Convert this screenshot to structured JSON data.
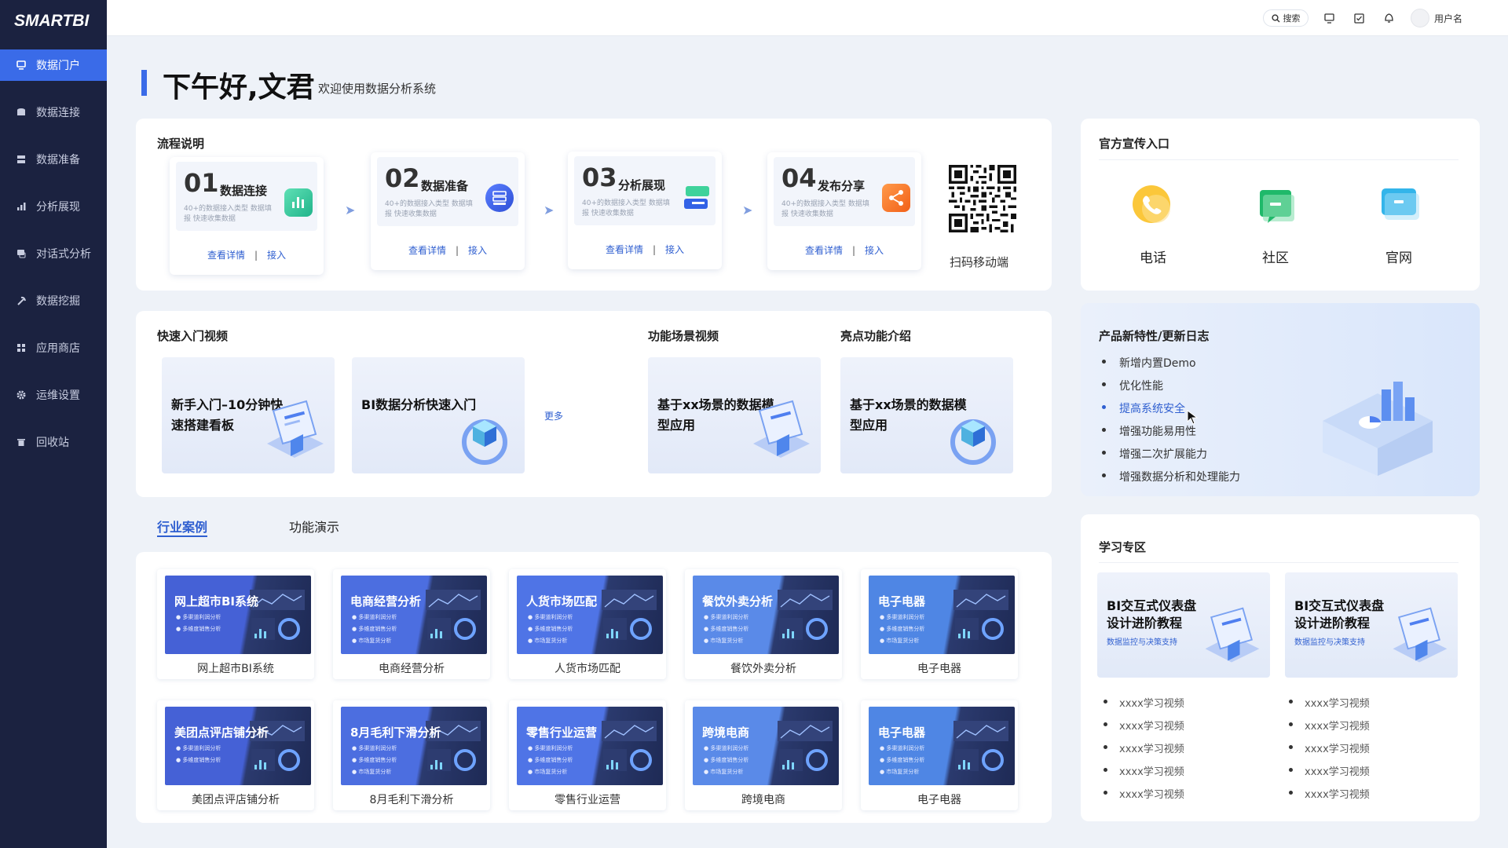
{
  "app": {
    "logo": "SMARTBI"
  },
  "sidebar": {
    "items": [
      {
        "label": "数据门户",
        "icon": "portal-icon"
      },
      {
        "label": "数据连接",
        "icon": "database-icon"
      },
      {
        "label": "数据准备",
        "icon": "prepare-icon"
      },
      {
        "label": "分析展现",
        "icon": "bar-chart-icon"
      },
      {
        "label": "对话式分析",
        "icon": "chat-icon"
      },
      {
        "label": "数据挖掘",
        "icon": "pickaxe-icon"
      },
      {
        "label": "应用商店",
        "icon": "apps-icon"
      },
      {
        "label": "运维设置",
        "icon": "gear-icon"
      },
      {
        "label": "回收站",
        "icon": "trash-icon"
      }
    ]
  },
  "topbar": {
    "search_label": "搜索",
    "username": "用户名"
  },
  "greeting": {
    "title": "下午好,文君",
    "subtitle": "欢迎使用数据分析系统"
  },
  "process": {
    "title": "流程说明",
    "steps": [
      {
        "num": "01",
        "name": "数据连接",
        "desc": "40+的数据接入类型 数据填报 快速收集数据",
        "detail": "查看详情",
        "access": "接入"
      },
      {
        "num": "02",
        "name": "数据准备",
        "desc": "40+的数据接入类型 数据填报 快速收集数据",
        "detail": "查看详情",
        "access": "接入"
      },
      {
        "num": "03",
        "name": "分析展现",
        "desc": "40+的数据接入类型 数据填报 快速收集数据",
        "detail": "查看详情",
        "access": "接入"
      },
      {
        "num": "04",
        "name": "发布分享",
        "desc": "40+的数据接入类型 数据填报 快速收集数据",
        "detail": "查看详情",
        "access": "接入"
      }
    ],
    "qr_label": "扫码移动端"
  },
  "promo": {
    "title": "官方宣传入口",
    "items": [
      {
        "label": "电话",
        "icon": "phone-icon"
      },
      {
        "label": "社区",
        "icon": "community-icon"
      },
      {
        "label": "官网",
        "icon": "website-icon"
      }
    ]
  },
  "videos": {
    "quick_title": "快速入门视频",
    "scene_title": "功能场景视频",
    "highlight_title": "亮点功能介绍",
    "more": "更多",
    "cards": [
      {
        "title": "新手入门–10分钟快速搭建看板"
      },
      {
        "title": "BI数据分析快速入门"
      },
      {
        "title": "基于xx场景的数据模型应用"
      },
      {
        "title": "基于xx场景的数据模型应用"
      }
    ]
  },
  "changelog": {
    "title": "产品新特性/更新日志",
    "items": [
      "新增内置Demo",
      "优化性能",
      "提高系统安全",
      "增强功能易用性",
      "增强二次扩展能力",
      "增强数据分析和处理能力"
    ]
  },
  "tabs": [
    {
      "label": "行业案例"
    },
    {
      "label": "功能演示"
    }
  ],
  "cases": [
    {
      "title": "网上超市BI系统",
      "caption": "网上超市BI系统",
      "bullets": [
        "多渠道利润分析",
        "多维度销售分析"
      ],
      "color": "#4561d6"
    },
    {
      "title": "电商经营分析",
      "caption": "电商经营分析",
      "bullets": [
        "多渠道利润分析",
        "多维度销售分析",
        "市场复货分析"
      ],
      "color": "#4c6ee0"
    },
    {
      "title": "人货市场匹配",
      "caption": "人货市场匹配",
      "bullets": [
        "多渠道利润分析",
        "多维度销售分析",
        "市场复货分析"
      ],
      "color": "#4f74e6"
    },
    {
      "title": "餐饮外卖分析",
      "caption": "餐饮外卖分析",
      "bullets": [
        "多渠道利润分析",
        "多维度销售分析",
        "市场复货分析"
      ],
      "color": "#5a8ae8"
    },
    {
      "title": "电子电器",
      "caption": "电子电器",
      "bullets": [
        "多渠道利润分析",
        "多维度销售分析",
        "市场复货分析"
      ],
      "color": "#4f86e4"
    },
    {
      "title": "美团点评店铺分析",
      "caption": "美团点评店铺分析",
      "bullets": [
        "多渠道利润分析",
        "多维度销售分析"
      ],
      "color": "#4561d6"
    },
    {
      "title": "8月毛利下滑分析",
      "caption": "8月毛利下滑分析",
      "bullets": [
        "多渠道利润分析",
        "多维度销售分析",
        "市场复货分析"
      ],
      "color": "#4c6ee0"
    },
    {
      "title": "零售行业运营",
      "caption": "零售行业运营",
      "bullets": [
        "多渠道利润分析",
        "多维度销售分析",
        "市场复货分析"
      ],
      "color": "#4f74e6"
    },
    {
      "title": "跨境电商",
      "caption": "跨境电商",
      "bullets": [
        "多渠道利润分析",
        "多维度销售分析",
        "市场复货分析"
      ],
      "color": "#5a8ae8"
    },
    {
      "title": "电子电器",
      "caption": "电子电器",
      "bullets": [
        "多渠道利润分析",
        "多维度销售分析",
        "市场复货分析"
      ],
      "color": "#4f86e4"
    }
  ],
  "learning": {
    "title": "学习专区",
    "cards": [
      {
        "title_1": "BI交互式仪表盘",
        "title_2": "设计进阶教程",
        "sub": "数据监控与决策支持"
      },
      {
        "title_1": "BI交互式仪表盘",
        "title_2": "设计进阶教程",
        "sub": "数据监控与决策支持"
      }
    ],
    "col1": [
      "xxxx学习视频",
      "xxxx学习视频",
      "xxxx学习视频",
      "xxxx学习视频",
      "xxxx学习视频"
    ],
    "col2": [
      "xxxx学习视频",
      "xxxx学习视频",
      "xxxx学习视频",
      "xxxx学习视频",
      "xxxx学习视频"
    ]
  }
}
